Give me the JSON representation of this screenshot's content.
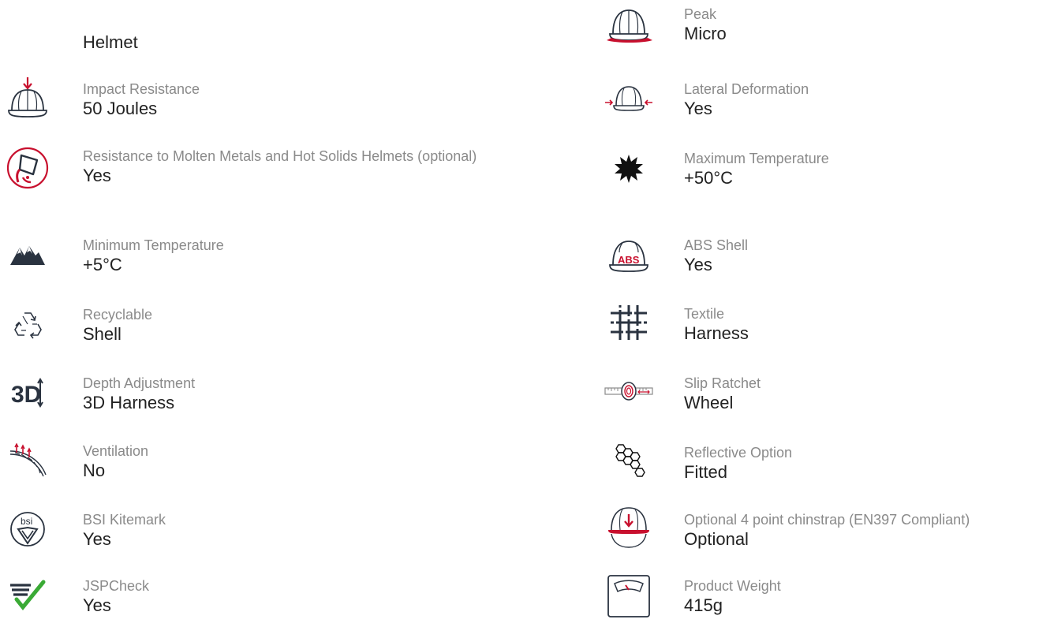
{
  "header": {
    "title": "Helmet"
  },
  "colors": {
    "label": "#8a8a8a",
    "value": "#222222",
    "icon_dark": "#2a3340",
    "icon_red": "#c8102e",
    "icon_green": "#3aaa35"
  },
  "left": [
    {
      "icon": "helmet-impact-icon",
      "label": "Impact Resistance",
      "value": "50 Joules"
    },
    {
      "icon": "molten-metal-icon",
      "label": "Resistance to Molten Metals and Hot Solids Helmets (optional)",
      "value": "Yes"
    },
    {
      "icon": "mountains-icon",
      "label": "Minimum Temperature",
      "value": "+5°C"
    },
    {
      "icon": "recycle-icon",
      "label": "Recyclable",
      "value": "Shell"
    },
    {
      "icon": "3d-adjust-icon",
      "label": "Depth Adjustment",
      "value": "3D Harness",
      "icon_text": "3D"
    },
    {
      "icon": "ventilation-icon",
      "label": "Ventilation",
      "value": "No"
    },
    {
      "icon": "bsi-kitemark-icon",
      "label": "BSI Kitemark",
      "value": "Yes",
      "icon_text": "bsi"
    },
    {
      "icon": "jspcheck-icon",
      "label": "JSPCheck",
      "value": "Yes"
    }
  ],
  "right": [
    {
      "icon": "helmet-peak-icon",
      "label": "Peak",
      "value": "Micro"
    },
    {
      "icon": "lateral-deformation-icon",
      "label": "Lateral Deformation",
      "value": "Yes"
    },
    {
      "icon": "sun-icon",
      "label": "Maximum Temperature",
      "value": "+50°C"
    },
    {
      "icon": "abs-shell-icon",
      "label": "ABS Shell",
      "value": "Yes",
      "icon_text": "ABS"
    },
    {
      "icon": "textile-icon",
      "label": "Textile",
      "value": "Harness"
    },
    {
      "icon": "slip-ratchet-icon",
      "label": "Slip Ratchet",
      "value": "Wheel"
    },
    {
      "icon": "hexagons-icon",
      "label": "Reflective Option",
      "value": "Fitted"
    },
    {
      "icon": "chinstrap-helmet-icon",
      "label": "Optional 4 point chinstrap (EN397 Compliant)",
      "value": "Optional"
    },
    {
      "icon": "weight-scale-icon",
      "label": "Product Weight",
      "value": "415g"
    }
  ]
}
